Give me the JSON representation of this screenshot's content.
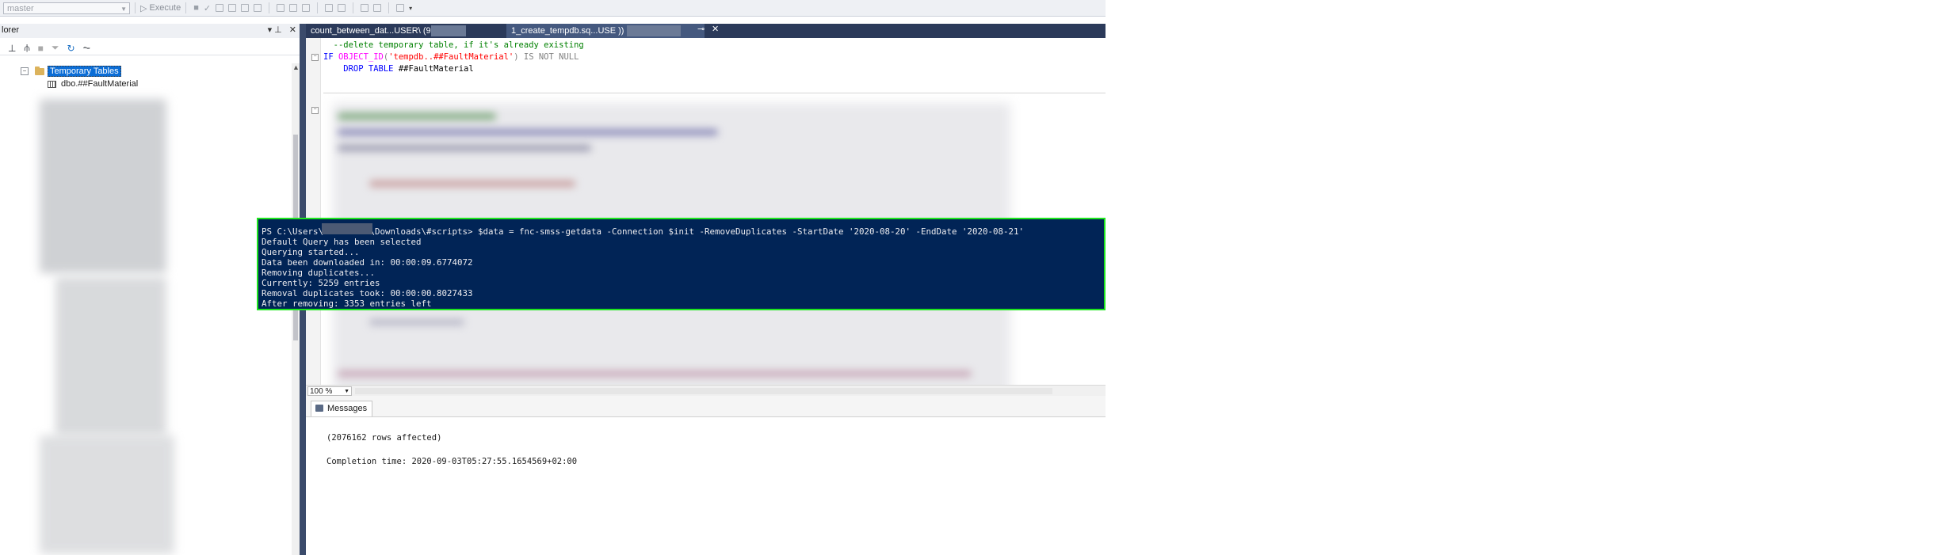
{
  "toolbar": {
    "database": "master",
    "execute_label": "Execute"
  },
  "explorer": {
    "title": "lorer",
    "pin_glyph": "▾ ⊥",
    "close_glyph": "✕",
    "tree": {
      "temp_tables_label": "Temporary Tables",
      "table_label": "dbo.##FaultMaterial"
    }
  },
  "tabs": {
    "tab1_label": "count_between_dat...USER\\         (98))",
    "tab2_label": "1_create_tempdb.sq...USE              ))",
    "pin_glyph": "⊸",
    "close_glyph": "✕"
  },
  "editor": {
    "line1": "--delete temporary table, if it's already existing",
    "line2_kw1": "IF ",
    "line2_fn": "OBJECT_ID",
    "line2_open": "(",
    "line2_str": "'tempdb..##FaultMaterial'",
    "line2_close": ")",
    "line2_kw2": " IS NOT NULL",
    "line3_kw": "    DROP TABLE",
    "line3_name": " ##FaultMaterial"
  },
  "terminal": {
    "lines": [
      "PS C:\\Users\\         \\Downloads\\#scripts> $data = fnc-smss-getdata -Connection $init -RemoveDuplicates -StartDate '2020-08-20' -EndDate '2020-08-21'",
      "Default Query has been selected",
      "Querying started...",
      "Data been downloaded in: 00:00:09.6774072",
      "Removing duplicates...",
      "Currently: 5259 entries",
      "Removal duplicates took: 00:00:00.8027433",
      "After removing: 3353 entries left"
    ],
    "colors": {
      "background": "#012456",
      "border": "#1ee51e",
      "text": "#eeedf0"
    }
  },
  "zoom": {
    "value": "100 %"
  },
  "results": {
    "tab_label": "Messages",
    "rows_affected": "(2076162 rows affected)",
    "completion": "Completion time: 2020-09-03T05:27:55.1654569+02:00"
  }
}
